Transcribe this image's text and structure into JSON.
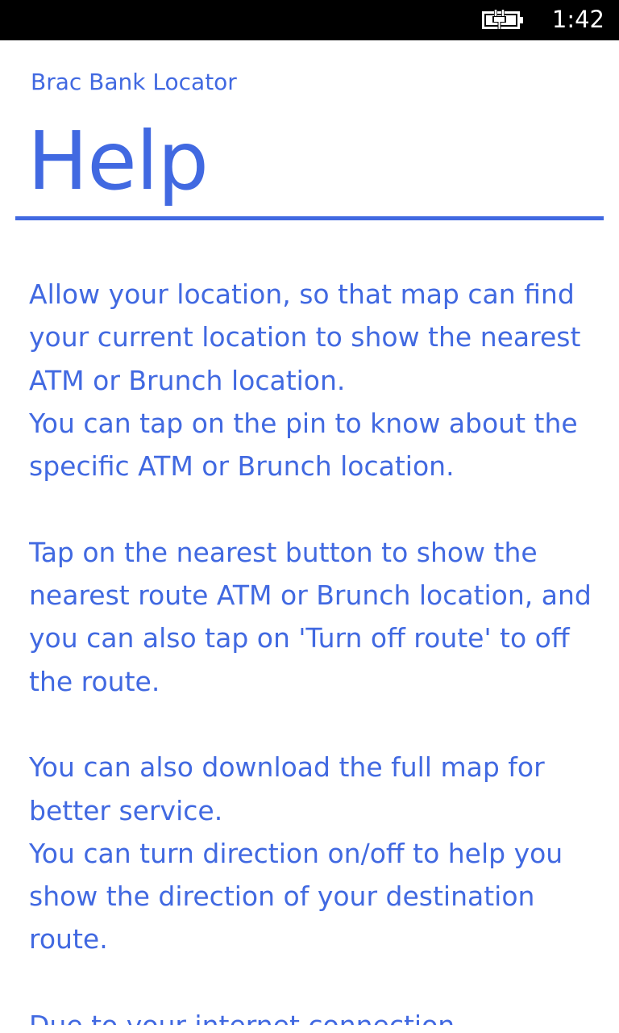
{
  "status_bar": {
    "time": "1:42",
    "battery_icon": "battery-charging-icon"
  },
  "header": {
    "app_title": "Brac Bank Locator",
    "page_title": "Help"
  },
  "content": {
    "paragraphs": [
      "Allow your location, so that map can find your current location to show the nearest ATM or Brunch location.\nYou can tap on the pin to know about the specific ATM or Brunch location.",
      "Tap on the nearest button to show the nearest route ATM or Brunch location, and you can also tap on 'Turn off route' to off the route.",
      "You can also download the full map for better service.\nYou can turn direction on/off to help you show the direction of your destination route.",
      "Due to your internet connection"
    ]
  },
  "colors": {
    "accent": "#4169e1",
    "background": "#ffffff",
    "status_bar": "#000000"
  }
}
